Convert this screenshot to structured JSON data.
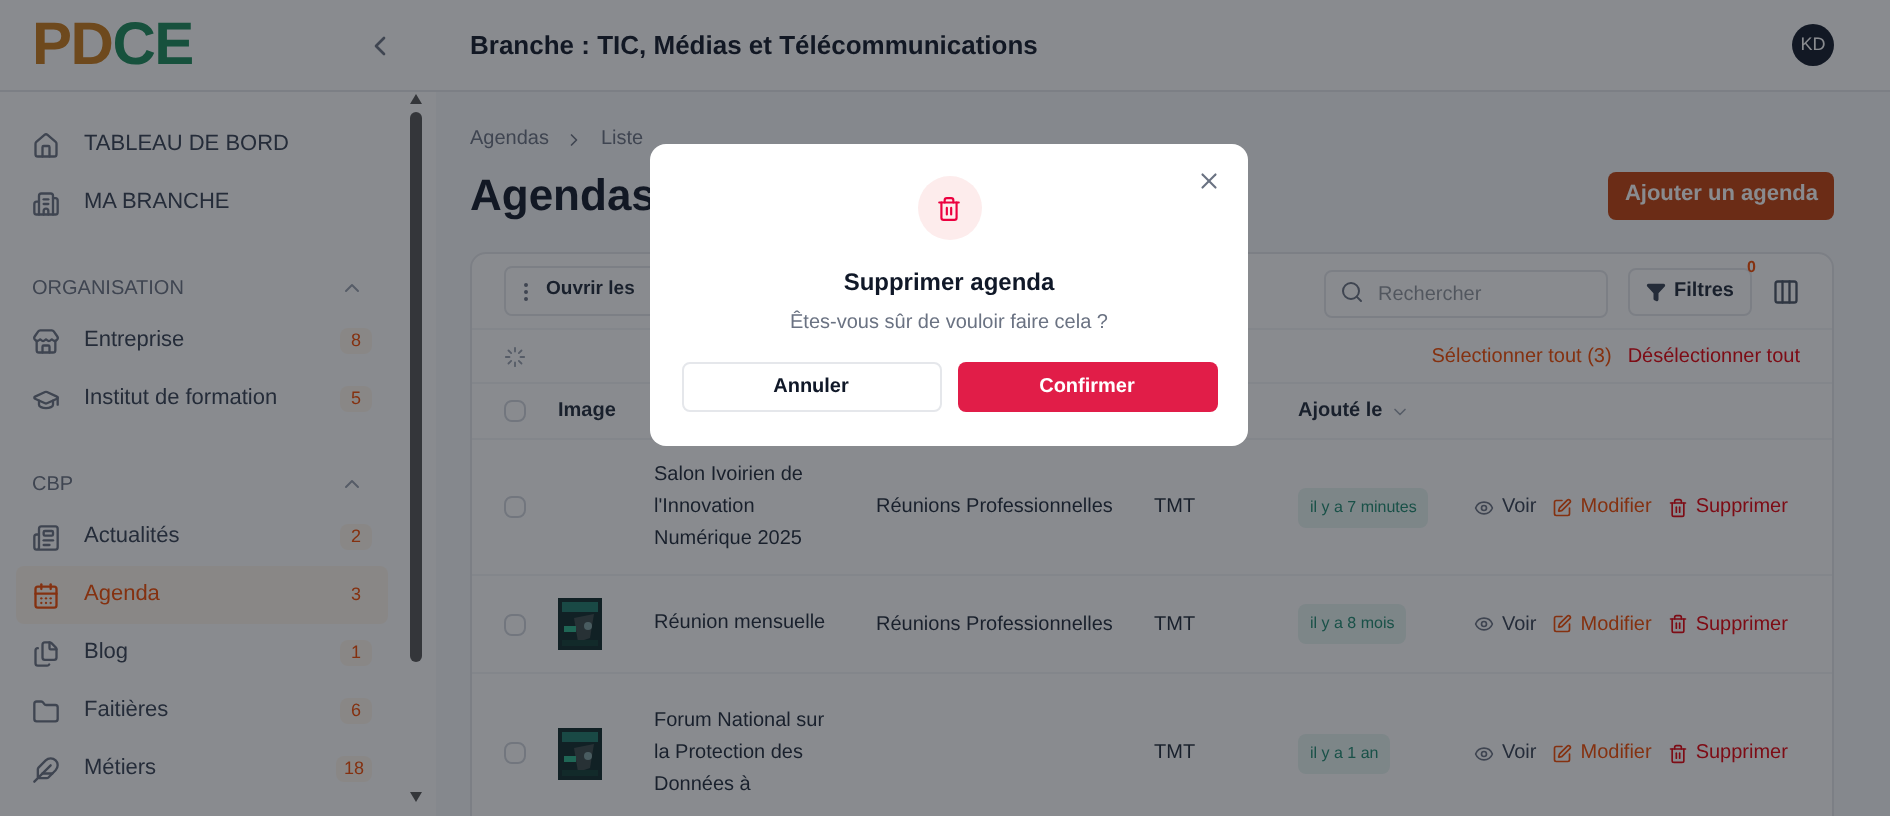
{
  "header": {
    "logo": "PDCE",
    "title": "Branche : TIC, Médias et Télécommunications",
    "avatar": "KD"
  },
  "sidebar": {
    "top_items": [
      {
        "label": "TABLEAU DE BORD"
      },
      {
        "label": "MA BRANCHE"
      }
    ],
    "sections": [
      {
        "title": "ORGANISATION",
        "expanded": true,
        "items": [
          {
            "label": "Entreprise",
            "count": "8",
            "selected": false
          },
          {
            "label": "Institut de formation",
            "count": "5",
            "selected": false
          }
        ]
      },
      {
        "title": "CBP",
        "expanded": true,
        "items": [
          {
            "label": "Actualités",
            "count": "2",
            "selected": false
          },
          {
            "label": "Agenda",
            "count": "3",
            "selected": true
          },
          {
            "label": "Blog",
            "count": "1",
            "selected": false
          },
          {
            "label": "Faitières",
            "count": "6",
            "selected": false
          },
          {
            "label": "Métiers",
            "count": "18",
            "selected": false
          }
        ]
      }
    ]
  },
  "main": {
    "breadcrumb": [
      "Agendas",
      "Liste"
    ],
    "title": "Agendas",
    "add_button": "Ajouter un agenda",
    "toolbar": {
      "open_button": "Ouvrir les",
      "search": {
        "placeholder": "Rechercher"
      },
      "filter_button": {
        "label": "Filtres",
        "count": "0"
      },
      "select_all": "Sélectionner tout (3)",
      "deselect_all": "Désélectionner tout"
    },
    "table": {
      "all_checked": false,
      "columns": [
        {
          "label": "Image",
          "sortable": false
        },
        {
          "label": "Ajouté le",
          "sortable": true
        }
      ],
      "rows": [
        {
          "checked": false,
          "has_image": false,
          "title": "Salon Ivoirien de l'Innovation Numérique 2025",
          "category": "Réunions Professionnelles",
          "author": "TMT",
          "added": "il y a 7 minutes",
          "actions": [
            "Voir",
            "Modifier",
            "Supprimer"
          ]
        },
        {
          "checked": false,
          "has_image": true,
          "title": "Réunion mensuelle",
          "category": "Réunions Professionnelles",
          "author": "TMT",
          "added": "il y a 8 mois",
          "actions": [
            "Voir",
            "Modifier",
            "Supprimer"
          ]
        },
        {
          "checked": false,
          "has_image": true,
          "title": "Forum National sur la Protection des Données à",
          "author": "TMT",
          "added": "il y a 1 an",
          "actions": [
            "Voir",
            "Modifier",
            "Supprimer"
          ]
        }
      ]
    }
  },
  "dialog": {
    "title": "Supprimer agenda",
    "message": "Êtes-vous sûr de vouloir faire cela ?",
    "buttons": [
      "Annuler",
      "Confirmer"
    ]
  }
}
